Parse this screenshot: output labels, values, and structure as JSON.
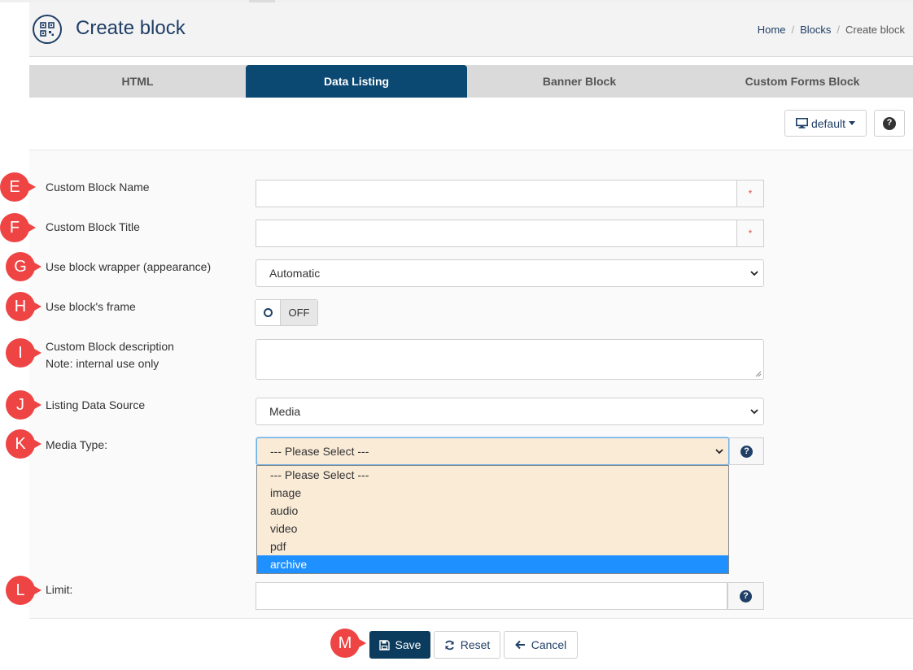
{
  "header": {
    "title": "Create block",
    "icon": "qr-block-icon",
    "breadcrumb": [
      "Home",
      "Blocks",
      "Create block"
    ]
  },
  "tabs": [
    {
      "label": "HTML",
      "active": false
    },
    {
      "label": "Data Listing",
      "active": true
    },
    {
      "label": "Banner Block",
      "active": false
    },
    {
      "label": "Custom Forms Block",
      "active": false
    }
  ],
  "toolbar": {
    "device_label": "default",
    "device_icon": "monitor-icon",
    "help_icon": "question-circle-icon"
  },
  "form": {
    "name_label": "Custom Block Name",
    "name_value": "",
    "required_mark": "*",
    "title_label": "Custom Block Title",
    "title_value": "",
    "wrapper_label": "Use block wrapper (appearance)",
    "wrapper_value": "Automatic",
    "frame_label": "Use block's frame",
    "frame_toggle": "OFF",
    "description_label": "Custom Block description",
    "description_note": "Note: internal use only",
    "description_value": "",
    "source_label": "Listing Data Source",
    "source_value": "Media",
    "media_type_label": "Media Type:",
    "media_type_value": "--- Please Select ---",
    "media_type_options": [
      "--- Please Select ---",
      "image",
      "audio",
      "video",
      "pdf",
      "archive"
    ],
    "media_type_highlighted": "archive",
    "limit_label": "Limit:",
    "limit_value": ""
  },
  "buttons": {
    "save": "Save",
    "reset": "Reset",
    "cancel": "Cancel"
  },
  "markers": [
    "E",
    "F",
    "G",
    "H",
    "I",
    "J",
    "K",
    "L",
    "M"
  ],
  "colors": {
    "primary": "#0b4872",
    "dark_primary": "#0b3c5d",
    "marker": "#ee4444",
    "dropdown_bg": "#faebd7",
    "highlight": "#1e90ff",
    "required": "#d9534f"
  }
}
